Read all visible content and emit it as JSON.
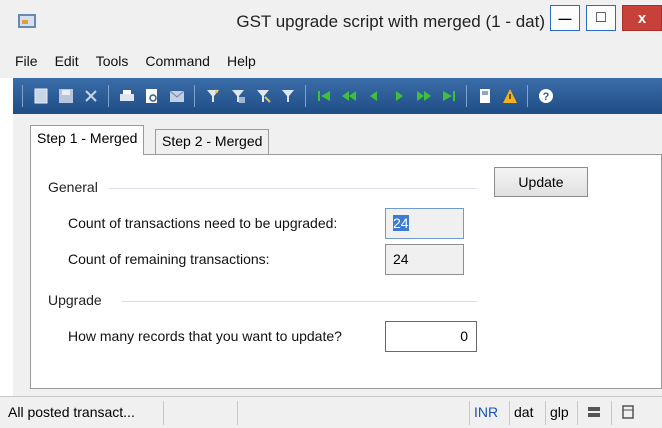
{
  "window": {
    "title": "GST upgrade script with merged (1 - dat)",
    "minimize_glyph": "—",
    "maximize_glyph": "□",
    "close_glyph": "x"
  },
  "menu": [
    "File",
    "Edit",
    "Tools",
    "Command",
    "Help"
  ],
  "toolbar": {
    "icons": [
      "new-record-icon",
      "save-icon",
      "delete-icon",
      "print-icon",
      "print-preview-icon",
      "email-icon",
      "filter-by-selection-icon",
      "filter-by-grid-icon",
      "advanced-filter-icon",
      "remove-filter-icon",
      "first-record-icon",
      "previous-page-icon",
      "previous-record-icon",
      "next-record-icon",
      "next-page-icon",
      "last-record-icon",
      "attachments-icon",
      "alerts-icon",
      "help-icon"
    ]
  },
  "tabs": [
    {
      "label": "Step 1 - Merged",
      "active": true
    },
    {
      "label": "Step 2 - Merged",
      "active": false
    }
  ],
  "general": {
    "title": "General",
    "count_upgrade_label": "Count of transactions need to be upgraded:",
    "count_upgrade_value": "24",
    "count_remaining_label": "Count of remaining transactions:",
    "count_remaining_value": "24"
  },
  "upgrade": {
    "title": "Upgrade",
    "records_label": "How many records that you want to update?",
    "records_value": "0"
  },
  "actions": {
    "update_label": "Update"
  },
  "statusbar": {
    "message": "All posted transact...",
    "currency": "INR",
    "company": "dat",
    "layer": "glp"
  },
  "colors": {
    "toolbar": "#2b5c97",
    "close_button": "#c7413a",
    "currency_text": "#1c50b6",
    "selection": "#3b7bd4"
  }
}
